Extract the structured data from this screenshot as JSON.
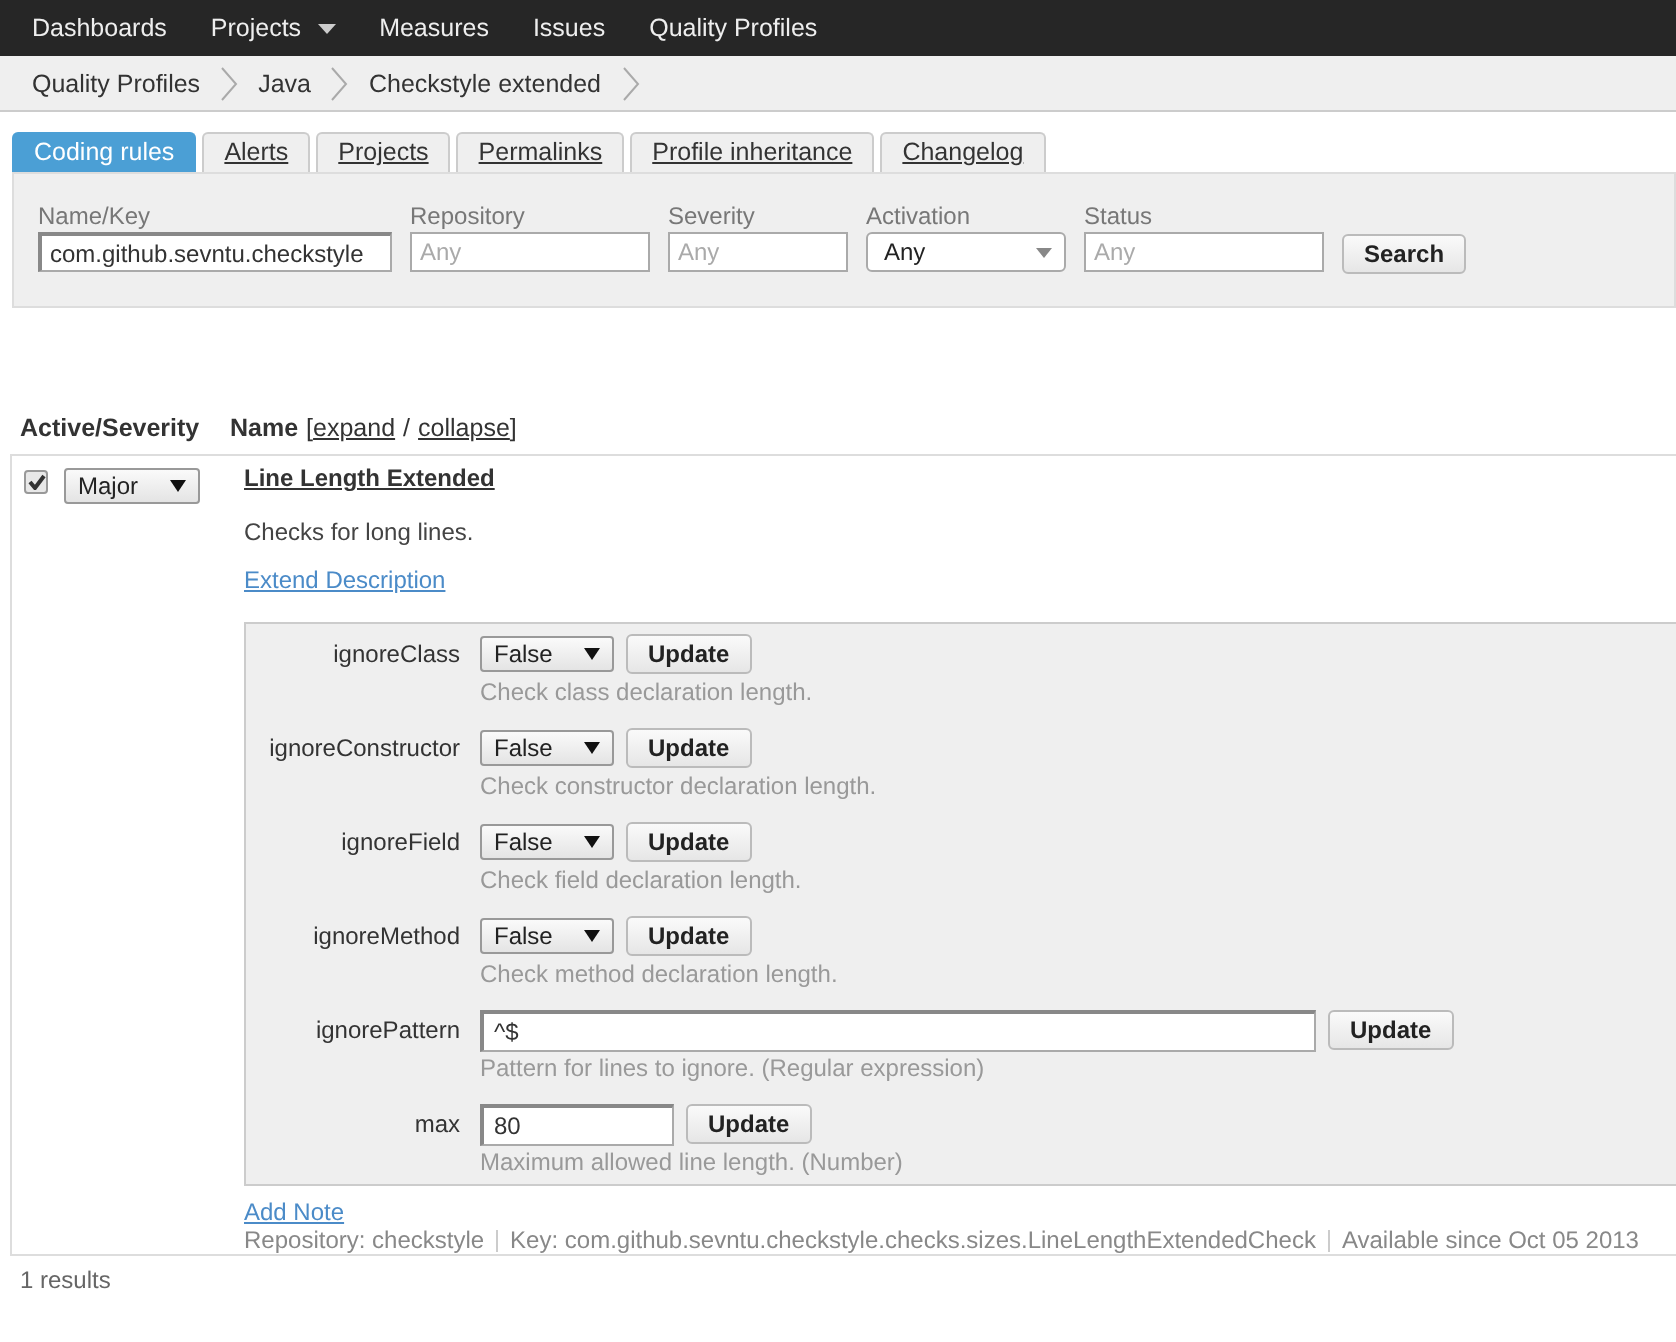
{
  "nav": [
    {
      "label": "Dashboards",
      "dropdown": false
    },
    {
      "label": "Projects",
      "dropdown": true
    },
    {
      "label": "Measures",
      "dropdown": false
    },
    {
      "label": "Issues",
      "dropdown": false
    },
    {
      "label": "Quality Profiles",
      "dropdown": false
    }
  ],
  "breadcrumb": [
    "Quality Profiles",
    "Java",
    "Checkstyle extended"
  ],
  "tabs": [
    {
      "label": "Coding rules",
      "selected": true
    },
    {
      "label": "Alerts",
      "selected": false
    },
    {
      "label": "Projects",
      "selected": false
    },
    {
      "label": "Permalinks",
      "selected": false
    },
    {
      "label": "Profile inheritance",
      "selected": false
    },
    {
      "label": "Changelog",
      "selected": false
    }
  ],
  "filters": [
    {
      "label": "Name/Key",
      "kind": "text",
      "value": "com.github.sevntu.checkstyle"
    },
    {
      "label": "Repository",
      "kind": "text",
      "placeholder": "Any"
    },
    {
      "label": "Severity",
      "kind": "text",
      "placeholder": "Any"
    },
    {
      "label": "Activation",
      "kind": "select",
      "value": "Any"
    },
    {
      "label": "Status",
      "kind": "text",
      "placeholder": "Any"
    }
  ],
  "search_button": "Search",
  "table": {
    "columns": [
      "Active/Severity",
      "Name"
    ],
    "open_bracket": "[",
    "expand": "expand",
    "separator": "/",
    "collapse": "collapse",
    "close_bracket": "]"
  },
  "rule": {
    "active": true,
    "severity": "Major",
    "name": "Line Length Extended",
    "description": "Checks for long lines.",
    "extend_link": "Extend Description",
    "params": [
      {
        "name": "ignoreClass",
        "kind": "select",
        "value": "False",
        "button": "Update",
        "hint": "Check class declaration length."
      },
      {
        "name": "ignoreConstructor",
        "kind": "select",
        "value": "False",
        "button": "Update",
        "hint": "Check constructor declaration length."
      },
      {
        "name": "ignoreField",
        "kind": "select",
        "value": "False",
        "button": "Update",
        "hint": "Check field declaration length."
      },
      {
        "name": "ignoreMethod",
        "kind": "select",
        "value": "False",
        "button": "Update",
        "hint": "Check method declaration length."
      },
      {
        "name": "ignorePattern",
        "kind": "wide",
        "value": "^$",
        "button": "Update",
        "hint": "Pattern for lines to ignore. (Regular expression)"
      },
      {
        "name": "max",
        "kind": "text",
        "value": "80",
        "button": "Update",
        "hint": "Maximum allowed line length. (Number)"
      }
    ],
    "add_note": "Add Note",
    "meta": [
      "Repository: checkstyle",
      "Key: com.github.sevntu.checkstyle.checks.sizes.LineLengthExtendedCheck",
      "Available since Oct 05 2013"
    ]
  },
  "results": "1 results"
}
